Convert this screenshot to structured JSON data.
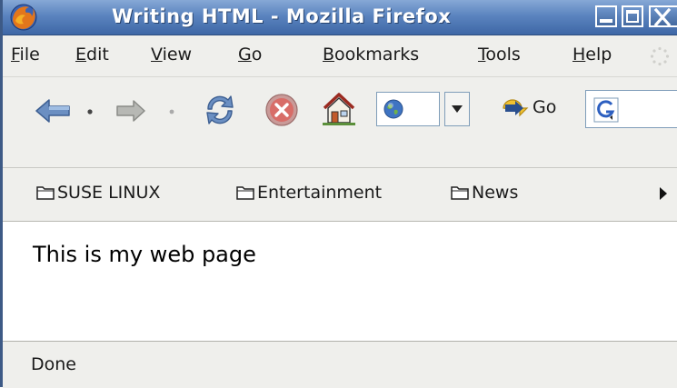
{
  "window": {
    "title": "Writing HTML - Mozilla Firefox",
    "title_color": "#ffffff",
    "titlebar_color": "#4f77b3"
  },
  "menu": {
    "items": [
      {
        "accel": "F",
        "rest": "ile"
      },
      {
        "accel": "E",
        "rest": "dit"
      },
      {
        "accel": "V",
        "rest": "iew"
      },
      {
        "accel": "G",
        "rest": "o"
      },
      {
        "accel": "B",
        "rest": "ookmarks"
      },
      {
        "accel": "T",
        "rest": "ools"
      },
      {
        "accel": "H",
        "rest": "elp"
      }
    ]
  },
  "toolbar": {
    "icons": [
      "back-arrow-icon",
      "forward-arrow-icon",
      "reload-icon",
      "stop-icon",
      "home-icon",
      "globe-icon",
      "dropdown-arrow-icon",
      "go-arrow-icon",
      "google-icon"
    ],
    "go_label": "Go",
    "url_value": "",
    "search_value": ""
  },
  "bookmarks": {
    "items": [
      {
        "label": "SUSE LINUX"
      },
      {
        "label": "Entertainment"
      },
      {
        "label": "News"
      }
    ]
  },
  "content": {
    "text": "This is my web page"
  },
  "status": {
    "text": "Done"
  }
}
